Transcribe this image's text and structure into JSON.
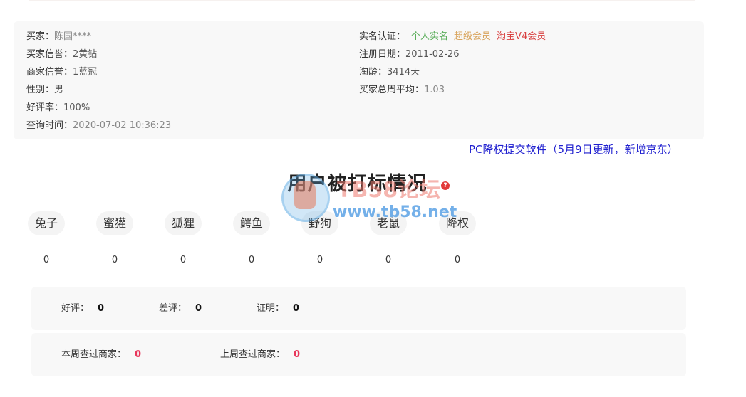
{
  "buyer_info": {
    "left": [
      {
        "label": "买家：",
        "value": "陈国****"
      },
      {
        "label": "买家信誉：",
        "value": "2黄钻"
      },
      {
        "label": "商家信誉：",
        "value": "1蓝冠"
      },
      {
        "label": "性别：",
        "value": "男"
      },
      {
        "label": "好评率：",
        "value": "100%"
      },
      {
        "label": "查询时间：",
        "value": "2020-07-02 10:36:23"
      }
    ],
    "right": {
      "realname_label": "实名认证：",
      "badges": [
        {
          "text": "个人实名",
          "color": "#5cae5c"
        },
        {
          "text": "超级会员",
          "color": "#d8a35a"
        },
        {
          "text": "淘宝V4会员",
          "color": "#d94040"
        }
      ],
      "rows": [
        {
          "label": "注册日期：",
          "value": "2011-02-26"
        },
        {
          "label": "淘龄：",
          "value": "3414天"
        },
        {
          "label": "买家总周平均：",
          "value": "1.03"
        }
      ]
    }
  },
  "pc_link": "PC降权提交软件（5月9日更新，新增京东）",
  "section_title": "用户被打标情况",
  "help_icon_glyph": "?",
  "tags": [
    {
      "name": "兔子",
      "count": "0"
    },
    {
      "name": "蜜獾",
      "count": "0"
    },
    {
      "name": "狐狸",
      "count": "0"
    },
    {
      "name": "鳄鱼",
      "count": "0"
    },
    {
      "name": "野狗",
      "count": "0"
    },
    {
      "name": "老鼠",
      "count": "0"
    },
    {
      "name": "降权",
      "count": "0"
    }
  ],
  "reviews": {
    "good_label": "好评：",
    "good_value": "0",
    "bad_label": "差评：",
    "bad_value": "0",
    "proof_label": "证明：",
    "proof_value": "0"
  },
  "merchant_checks": {
    "this_week_label": "本周查过商家：",
    "this_week_value": "0",
    "last_week_label": "上周查过商家：",
    "last_week_value": "0"
  },
  "watermark": {
    "text1": "TB58论坛",
    "text2": "www.tb58.net"
  }
}
